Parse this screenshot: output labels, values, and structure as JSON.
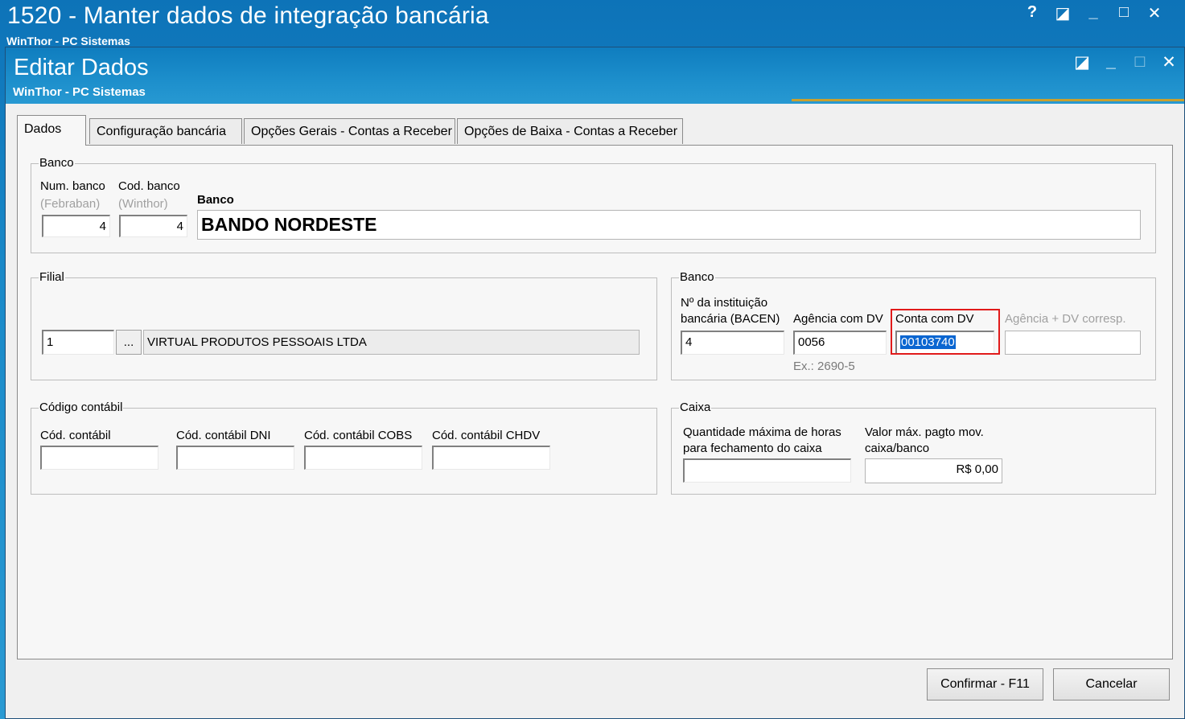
{
  "outer_window": {
    "title": "1520 - Manter dados de integração bancária",
    "subtitle": "WinThor - PC Sistemas",
    "controls": [
      "?",
      "◪",
      "_",
      "□",
      "✕"
    ]
  },
  "dialog": {
    "title": "Editar Dados",
    "subtitle": "WinThor - PC Sistemas",
    "controls": [
      "◪",
      "_",
      "□",
      "✕"
    ]
  },
  "tabs": [
    {
      "label": "Dados",
      "active": true
    },
    {
      "label": "Configuração bancária"
    },
    {
      "label": "Opções Gerais - Contas a Receber"
    },
    {
      "label": "Opções de Baixa - Contas a Receber"
    }
  ],
  "banco_group": {
    "legend": "Banco",
    "num_banco_label": "Num. banco",
    "num_banco_hint": "(Febraban)",
    "num_banco_value": "4",
    "cod_banco_label": "Cod. banco",
    "cod_banco_hint": "(Winthor)",
    "cod_banco_value": "4",
    "banco_label": "Banco",
    "banco_value": "BANDO NORDESTE"
  },
  "filial_group": {
    "legend": "Filial",
    "code_value": "1",
    "lookup_label": "...",
    "name_value": "VIRTUAL PRODUTOS PESSOAIS LTDA"
  },
  "banco_account_group": {
    "legend": "Banco",
    "instituicao_label_1": "Nº da instituição",
    "instituicao_label_2": "bancária (BACEN)",
    "instituicao_value": "4",
    "agencia_label": "Agência com DV",
    "agencia_value": "0056",
    "agencia_example": "Ex.: 2690-5",
    "conta_label": "Conta com DV",
    "conta_value": "00103740",
    "agencia_corresp_label": "Agência + DV corresp.",
    "agencia_corresp_value": ""
  },
  "codigo_contabil_group": {
    "legend": "Código contábil",
    "fields": [
      {
        "label": "Cód. contábil",
        "value": ""
      },
      {
        "label": "Cód. contábil DNI",
        "value": ""
      },
      {
        "label": "Cód. contábil COBS",
        "value": ""
      },
      {
        "label": "Cód. contábil CHDV",
        "value": ""
      }
    ]
  },
  "caixa_group": {
    "legend": "Caixa",
    "horas_label_1": "Quantidade máxima de horas",
    "horas_label_2": "para fechamento do caixa",
    "horas_value": "",
    "valor_label_1": "Valor máx. pagto mov.",
    "valor_label_2": "caixa/banco",
    "valor_value": "R$ 0,00"
  },
  "buttons": {
    "confirm": "Confirmar - F11",
    "cancel": "Cancelar"
  },
  "colors": {
    "titlebar": "#1a8ac9",
    "highlight_border": "#e11b1b",
    "selection": "#0a66d1"
  }
}
